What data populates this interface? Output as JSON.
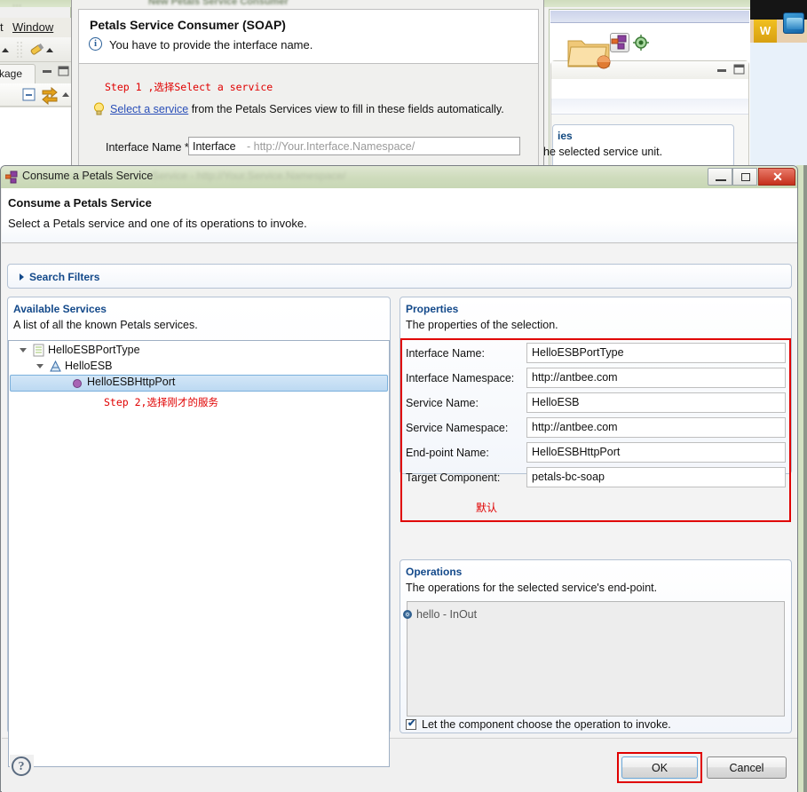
{
  "background": {
    "menu": {
      "file_trunc": "t",
      "window": "Window"
    },
    "tab_label": "kage",
    "ghost_title": "...",
    "section_title": "ies",
    "section_desc": "he selected service unit.",
    "w_badge": "W"
  },
  "wizard": {
    "titlebar_ghost": "New Petals Service Consumer",
    "title": "Petals Service Consumer (SOAP)",
    "message": "You have to provide the interface name.",
    "info_icon": "i",
    "step1_note": "Step 1 ,选择Select a service",
    "hint_link": "Select a service",
    "hint_rest": " from the Petals Services view to fill in these fields automatically.",
    "interface_label": "Interface Name *:",
    "interface_value": "Interface",
    "interface_placeholder": "-  http://Your.Interface.Namespace/"
  },
  "dialog": {
    "window_title": "Consume a Petals Service",
    "window_title_ghost": "Service        -  http://Your.Service.Namespace/",
    "header_title": "Consume a Petals Service",
    "header_desc": "Select a Petals service and one of its operations to invoke.",
    "minimize_tooltip": "Minimize",
    "maximize_tooltip": "Maximize",
    "close_label": "✕",
    "search_filters": {
      "label": "Search Filters",
      "expanded": false
    },
    "available_services": {
      "title": "Available Services",
      "desc": "A list of all the known Petals services.",
      "tree": [
        {
          "label": "HelloESBPortType",
          "level": 0,
          "icon": "document-icon",
          "expanded": true,
          "selected": false
        },
        {
          "label": "HelloESB",
          "level": 1,
          "icon": "service-icon",
          "expanded": true,
          "selected": false
        },
        {
          "label": "HelloESBHttpPort",
          "level": 2,
          "icon": "endpoint-icon",
          "expanded": false,
          "selected": true
        }
      ],
      "step2_note": "Step 2,选择刚才的服务"
    },
    "properties": {
      "title": "Properties",
      "desc": "The properties of the selection.",
      "annotation": "默认",
      "rows": [
        {
          "label": "Interface Name:",
          "value": "HelloESBPortType"
        },
        {
          "label": "Interface Namespace:",
          "value": "http://antbee.com"
        },
        {
          "label": "Service Name:",
          "value": "HelloESB"
        },
        {
          "label": "Service Namespace:",
          "value": "http://antbee.com"
        },
        {
          "label": "End-point Name:",
          "value": "HelloESBHttpPort"
        },
        {
          "label": "Target Component:",
          "value": "petals-bc-soap"
        }
      ]
    },
    "operations": {
      "title": "Operations",
      "desc": "The operations for the selected service's end-point.",
      "items": [
        {
          "label": "hello - InOut"
        }
      ],
      "checkbox_label": "Let the component choose the operation to invoke.",
      "checkbox_checked": true,
      "checkbox_tick": "✔"
    },
    "footer": {
      "help_label": "?",
      "ok_label": "OK",
      "cancel_label": "Cancel"
    }
  },
  "colors": {
    "accent_blue": "#13498a",
    "highlight_red": "#e00000",
    "selection_blue": "#bcd9f2",
    "titlebar_green": "#cfdcbd",
    "close_red": "#c5301b"
  }
}
